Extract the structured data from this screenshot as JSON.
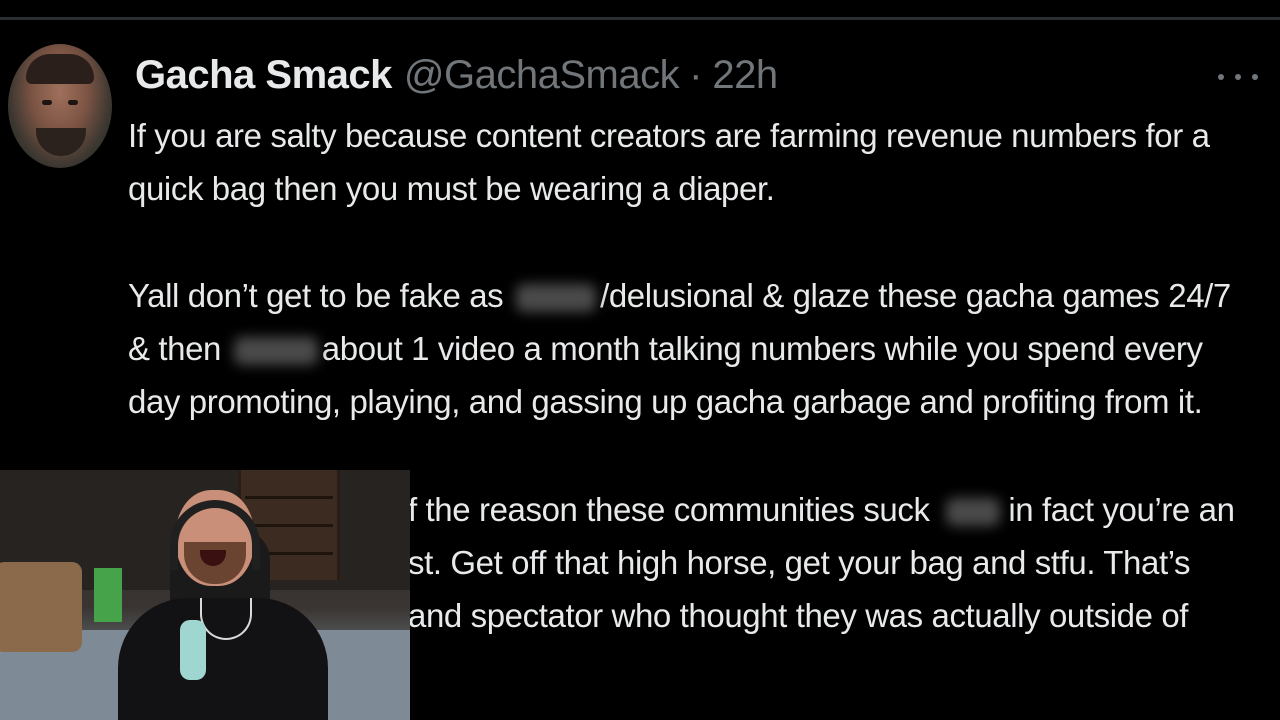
{
  "tweet": {
    "display_name": "Gacha Smack",
    "handle": "@GachaSmack",
    "separator": "·",
    "time": "22h",
    "avatar_icon": "user-avatar",
    "more_icon": "more-horizontal-icon",
    "paragraph1": {
      "line1": "If you are salty because content creators are farming revenue numbers for a",
      "line2": "quick bag then you must be wearing a diaper."
    },
    "paragraph2": {
      "line1_a": "Yall don’t get to be fake as",
      "line1_b": "/delusional & glaze these gacha games 24/7",
      "line2_a": "& then",
      "line2_b": "about 1 video a month talking numbers while you spend every",
      "line3": "day promoting, playing, and gassing up gacha garbage and profiting from it."
    },
    "paragraph3": {
      "line1_a": "f the reason these communities suck",
      "line1_b": "in fact you’re an",
      "line2": "st.  Get off that high horse, get your bag and stfu. That’s",
      "line3": "and spectator who thought they was actually outside of"
    }
  },
  "colors": {
    "background": "#000000",
    "text_primary": "#e7e9ea",
    "text_secondary": "#71767b",
    "divider": "#2a2d31"
  }
}
